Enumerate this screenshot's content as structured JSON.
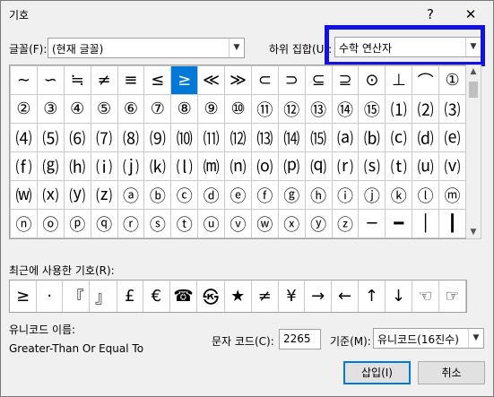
{
  "window": {
    "title": "기호",
    "help_label": "?",
    "close_label": "✕"
  },
  "font": {
    "label": "글꼴(F):",
    "value": "(현재 글꼴)"
  },
  "subset": {
    "label": "하위 집합(U):",
    "value": "수학 연산자"
  },
  "grid_rows": [
    [
      "∼",
      "∽",
      "≒",
      "≠",
      "≡",
      "≤",
      "≥",
      "≪",
      "≫",
      "⊂",
      "⊃",
      "⊆",
      "⊇",
      "⊙",
      "⊥",
      "⌒",
      "①"
    ],
    [
      "②",
      "③",
      "④",
      "⑤",
      "⑥",
      "⑦",
      "⑧",
      "⑨",
      "⑩",
      "⑪",
      "⑫",
      "⑬",
      "⑭",
      "⑮",
      "⑴",
      "⑵",
      "⑶"
    ],
    [
      "⑷",
      "⑸",
      "⑹",
      "⑺",
      "⑻",
      "⑼",
      "⑽",
      "⑾",
      "⑿",
      "⒀",
      "⒁",
      "⒂",
      "⒜",
      "⒝",
      "⒞",
      "⒟",
      "⒠"
    ],
    [
      "⒡",
      "⒢",
      "⒣",
      "⒤",
      "⒥",
      "⒦",
      "⒧",
      "⒨",
      "⒩",
      "⒪",
      "⒫",
      "⒬",
      "⒭",
      "⒮",
      "⒯",
      "⒰",
      "⒱"
    ],
    [
      "⒲",
      "⒳",
      "⒴",
      "⒵",
      "ⓐ",
      "ⓑ",
      "ⓒ",
      "ⓓ",
      "ⓔ",
      "ⓕ",
      "ⓖ",
      "ⓗ",
      "ⓘ",
      "ⓙ",
      "ⓚ",
      "ⓛ",
      "ⓜ"
    ],
    [
      "ⓝ",
      "ⓞ",
      "ⓟ",
      "ⓠ",
      "ⓡ",
      "ⓢ",
      "ⓣ",
      "ⓤ",
      "ⓥ",
      "ⓦ",
      "ⓧ",
      "ⓨ",
      "ⓩ",
      "─",
      "━",
      "│",
      "┃"
    ]
  ],
  "selected_symbol": "≥",
  "recent": {
    "label": "최근에 사용한 기호(R):",
    "symbols": [
      "≥",
      "·",
      "『",
      "』",
      "£",
      "€",
      "☎",
      "㉿",
      "★",
      "≠",
      "¥",
      "→",
      "←",
      "↑",
      "↓",
      "☜",
      "☞"
    ]
  },
  "unicode_name": {
    "label": "유니코드 이름:",
    "value": "Greater-Than Or Equal To"
  },
  "char_code": {
    "label": "문자 코드(C):",
    "value": "2265"
  },
  "from": {
    "label": "기준(M):",
    "value": "유니코드(16진수)"
  },
  "buttons": {
    "insert": "삽입(I)",
    "cancel": "취소"
  }
}
